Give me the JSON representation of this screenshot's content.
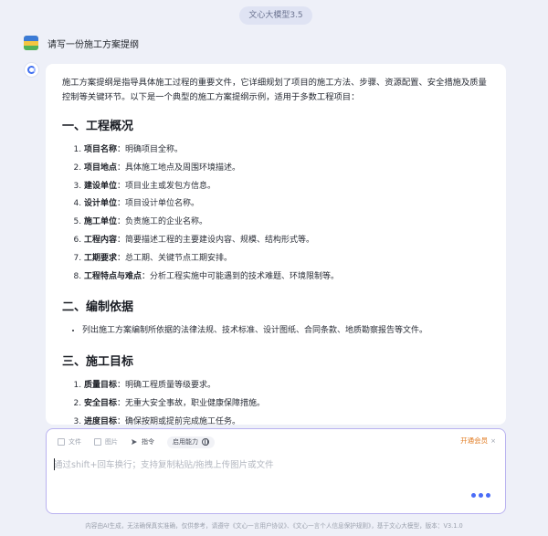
{
  "header": {
    "model_label": "文心大模型3.5"
  },
  "user_message": {
    "text": "请写一份施工方案提纲"
  },
  "answer": {
    "intro": "施工方案提纲是指导具体施工过程的重要文件，它详细规划了项目的施工方法、步骤、资源配置、安全措施及质量控制等关键环节。以下是一个典型的施工方案提纲示例，适用于多数工程项目：",
    "sections": [
      {
        "title": "一、工程概况",
        "items": [
          {
            "label": "项目名称",
            "text": "：明确项目全称。"
          },
          {
            "label": "项目地点",
            "text": "：具体施工地点及周围环境描述。"
          },
          {
            "label": "建设单位",
            "text": "：项目业主或发包方信息。"
          },
          {
            "label": "设计单位",
            "text": "：项目设计单位名称。"
          },
          {
            "label": "施工单位",
            "text": "：负责施工的企业名称。"
          },
          {
            "label": "工程内容",
            "text": "：简要描述工程的主要建设内容、规模、结构形式等。"
          },
          {
            "label": "工期要求",
            "text": "：总工期、关键节点工期安排。"
          },
          {
            "label": "工程特点与难点",
            "text": "：分析工程实施中可能遇到的技术难题、环境限制等。"
          }
        ]
      },
      {
        "title": "二、编制依据",
        "bullets": [
          "列出施工方案编制所依据的法律法规、技术标准、设计图纸、合同条款、地质勘察报告等文件。"
        ]
      },
      {
        "title": "三、施工目标",
        "items": [
          {
            "label": "质量目标",
            "text": "：明确工程质量等级要求。"
          },
          {
            "label": "安全目标",
            "text": "：无重大安全事故，职业健康保障措施。"
          },
          {
            "label": "进度目标",
            "text": "：确保按期或提前完成施工任务。"
          }
        ]
      }
    ]
  },
  "composer": {
    "tools": {
      "file": "文件",
      "image": "图片",
      "command": "指令",
      "ability": "启用能力"
    },
    "vip_label": "开通会员",
    "vip_close": "×",
    "placeholder": "通过shift+回车换行；支持复制粘贴/拖拽上传图片或文件"
  },
  "footer": {
    "text": "内容由AI生成，无法确保真实准确，仅供参考，请遵守《文心一言用户协议》、《文心一言个人信息保护规则》，基于文心大模型，版本：V3.1.0"
  }
}
